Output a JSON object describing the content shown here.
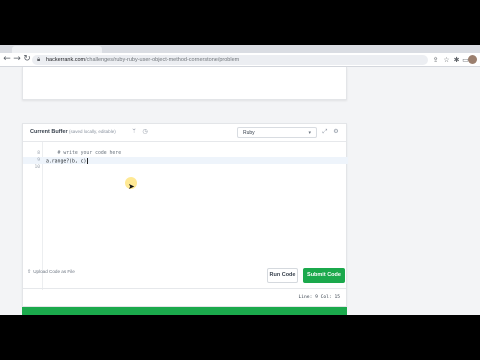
{
  "browser": {
    "url_host": "hackerrank.com",
    "url_path": "/challenges/ruby-ruby-user-object-method-cornerstone/problem",
    "icons": [
      "back-arrow-icon",
      "forward-arrow-icon",
      "reload-icon",
      "lock-icon",
      "share-icon",
      "star-icon",
      "extensions-icon",
      "split-view-icon",
      "avatar"
    ]
  },
  "editor": {
    "title": "Current Buffer",
    "note": "(saved locally, editable)",
    "language": "Ruby",
    "lines": [
      {
        "number": "8",
        "text": "    # write your code here",
        "style": "comment"
      },
      {
        "number": "9",
        "text": "a.range?(b, c)",
        "style": "plain",
        "active": true
      },
      {
        "number": "10",
        "text": "",
        "style": "plain"
      }
    ],
    "status": "Line: 9 Col: 15"
  },
  "actions": {
    "upload_label": "Upload Code as File",
    "run_label": "Run Code",
    "submit_label": "Submit Code"
  },
  "colors": {
    "accent": "#1ba94c",
    "active_line": "#eef4fb"
  }
}
